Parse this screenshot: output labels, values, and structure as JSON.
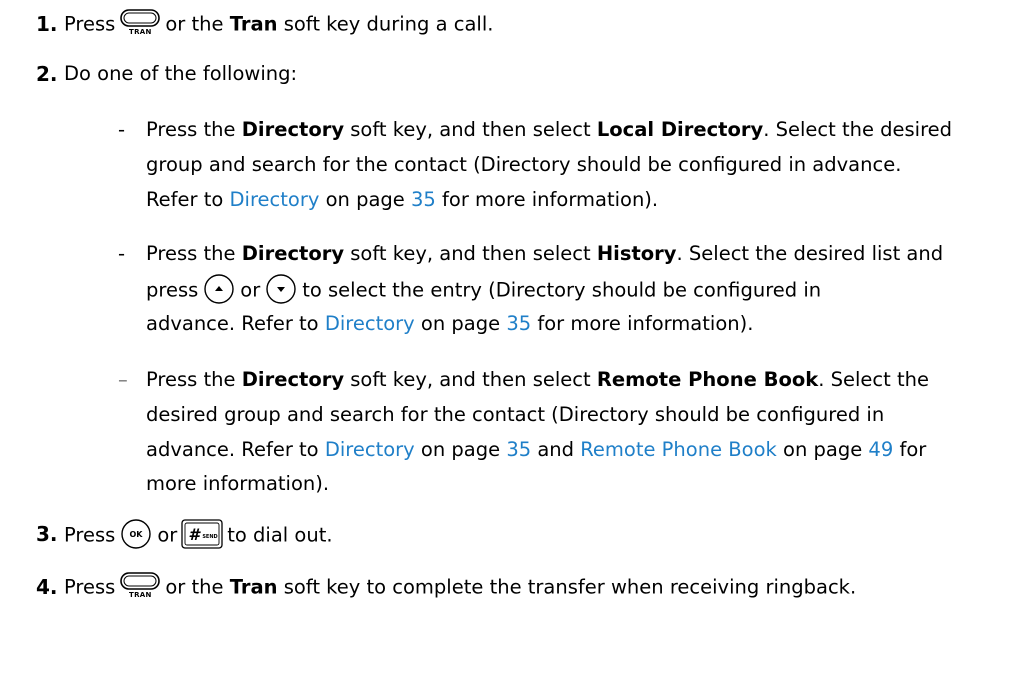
{
  "steps": {
    "s1": {
      "num": "1.",
      "pre": "Press",
      "or": "or the",
      "key": "Tran",
      "post": "soft key during a call.",
      "icon_label": "TRAN"
    },
    "s2": {
      "num": "2.",
      "text": "Do one of the following:"
    },
    "b1": {
      "dash": "-",
      "l1a": "Press the",
      "l1b": "Directory",
      "l1c": "soft key, and then select",
      "l1d": "Local Directory",
      "l1e": ". Select the desired",
      "l2": "group and search for the contact (Directory should be configured in advance.",
      "l3a": "Refer to",
      "l3b": "Directory",
      "l3c": "on page",
      "l3d": "35",
      "l3e": "for more information)."
    },
    "b2": {
      "dash": "-",
      "l1a": "Press the",
      "l1b": "Directory",
      "l1c": "soft key, and then select",
      "l1d": "History",
      "l1e": ". Select the desired list and",
      "l2a": "press",
      "l2b": "or",
      "l2c": "to select the entry (Directory should be configured in",
      "l3a": "advance. Refer to",
      "l3b": "Directory",
      "l3c": "on page",
      "l3d": "35",
      "l3e": "for more information)."
    },
    "b3": {
      "dash": "–",
      "l1a": "Press the",
      "l1b": "Directory",
      "l1c": "soft key, and then select",
      "l1d": "Remote Phone Book",
      "l1e": ". Select the",
      "l2": "desired group and search for the contact (Directory should be configured in",
      "l3a": "advance. Refer to",
      "l3b": "Directory",
      "l3c": "on page",
      "l3d": "35",
      "l3e": "and",
      "l3f": "Remote Phone Book",
      "l3g": "on page",
      "l3h": "49",
      "l3i": "for",
      "l4": "more information)."
    },
    "s3": {
      "num": "3.",
      "pre": "Press",
      "or": "or",
      "post": "to dial out.",
      "ok_label": "OK",
      "hash_label": "#",
      "send_label": "SEND"
    },
    "s4": {
      "num": "4.",
      "pre": "Press",
      "or": "or the",
      "key": "Tran",
      "post": "soft key to complete the transfer when receiving ringback.",
      "icon_label": "TRAN"
    }
  },
  "colors": {
    "link": "#1f7fc8",
    "text": "#000000"
  },
  "icons": [
    "transfer-key-icon",
    "up-arrow-key-icon",
    "down-arrow-key-icon",
    "ok-key-icon",
    "hash-send-key-icon"
  ]
}
